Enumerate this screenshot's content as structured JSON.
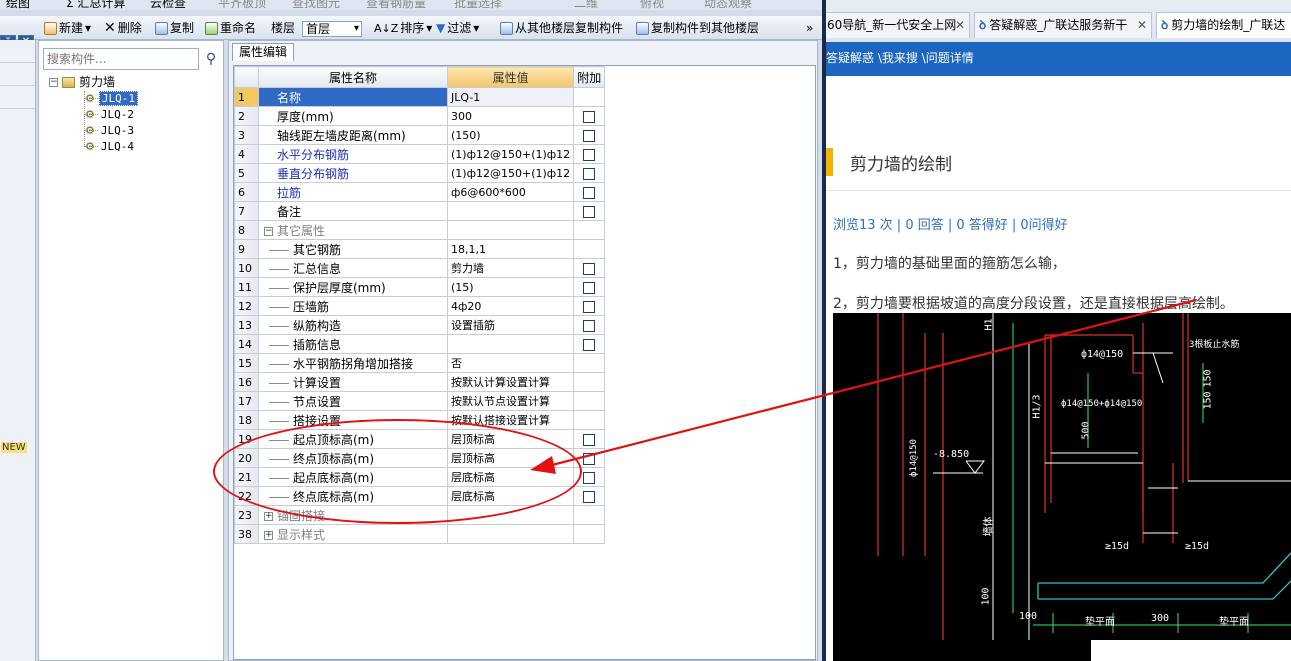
{
  "toolbar_top": {
    "items": [
      "绘图",
      "Σ 汇总计算",
      "云检查",
      "平齐板顶",
      "查找图元",
      "查看钢筋量",
      "批量选择",
      "二维",
      "俯视",
      "动态观察"
    ]
  },
  "toolbar": {
    "new_label": "新建",
    "delete_label": "删除",
    "copy_label": "复制",
    "rename_label": "重命名",
    "floor_label": "楼层",
    "floor_value": "首层",
    "sort_label": "排序",
    "filter_label": "过滤",
    "copy_from_floor_label": "从其他楼层复制构件",
    "copy_to_floor_label": "复制构件到其他楼层",
    "more_label": "»"
  },
  "left_strip": {
    "new_tag": "NEW"
  },
  "tree_panel": {
    "search_placeholder": "搜索构件...",
    "root_label": "剪力墙",
    "items": [
      "JLQ-1",
      "JLQ-2",
      "JLQ-3",
      "JLQ-4"
    ],
    "selected_item": "JLQ-1"
  },
  "property_panel": {
    "tab_label": "属性编辑",
    "columns": [
      "属性名称",
      "属性值",
      "附加"
    ],
    "rows": [
      {
        "num": "1",
        "name": "名称",
        "value": "JLQ-1",
        "check": false,
        "style": "selected"
      },
      {
        "num": "2",
        "name": "厚度(mm)",
        "value": "300",
        "check": true,
        "style": "normal"
      },
      {
        "num": "3",
        "name": "轴线距左墙皮距离(mm)",
        "value": "(150)",
        "check": true,
        "style": "normal"
      },
      {
        "num": "4",
        "name": "水平分布钢筋",
        "value": "(1)ф12@150+(1)ф12",
        "check": true,
        "style": "blue"
      },
      {
        "num": "5",
        "name": "垂直分布钢筋",
        "value": "(1)ф12@150+(1)ф12",
        "check": true,
        "style": "blue"
      },
      {
        "num": "6",
        "name": "拉筋",
        "value": "ф6@600*600",
        "check": true,
        "style": "blue"
      },
      {
        "num": "7",
        "name": "备注",
        "value": "",
        "check": true,
        "style": "normal"
      },
      {
        "num": "8",
        "name": "其它属性",
        "value": "",
        "check": false,
        "style": "group",
        "expander": "−"
      },
      {
        "num": "9",
        "name": "其它钢筋",
        "value": "18,1,1",
        "check": false,
        "style": "sub"
      },
      {
        "num": "10",
        "name": "汇总信息",
        "value": "剪力墙",
        "check": true,
        "style": "sub"
      },
      {
        "num": "11",
        "name": "保护层厚度(mm)",
        "value": "(15)",
        "check": true,
        "style": "sub"
      },
      {
        "num": "12",
        "name": "压墙筋",
        "value": "4ф20",
        "check": true,
        "style": "sub"
      },
      {
        "num": "13",
        "name": "纵筋构造",
        "value": "设置插筋",
        "check": true,
        "style": "sub"
      },
      {
        "num": "14",
        "name": "插筋信息",
        "value": "",
        "check": true,
        "style": "sub"
      },
      {
        "num": "15",
        "name": "水平钢筋拐角增加搭接",
        "value": "否",
        "check": false,
        "style": "sub"
      },
      {
        "num": "16",
        "name": "计算设置",
        "value": "按默认计算设置计算",
        "check": false,
        "style": "sub"
      },
      {
        "num": "17",
        "name": "节点设置",
        "value": "按默认节点设置计算",
        "check": false,
        "style": "sub"
      },
      {
        "num": "18",
        "name": "搭接设置",
        "value": "按默认搭接设置计算",
        "check": false,
        "style": "sub"
      },
      {
        "num": "19",
        "name": "起点顶标高(m)",
        "value": "层顶标高",
        "check": true,
        "style": "sub"
      },
      {
        "num": "20",
        "name": "终点顶标高(m)",
        "value": "层顶标高",
        "check": true,
        "style": "sub"
      },
      {
        "num": "21",
        "name": "起点底标高(m)",
        "value": "层底标高",
        "check": true,
        "style": "sub"
      },
      {
        "num": "22",
        "name": "终点底标高(m)",
        "value": "层底标高",
        "check": true,
        "style": "sub"
      },
      {
        "num": "23",
        "name": "锚固搭接",
        "value": "",
        "check": false,
        "style": "group",
        "expander": "+"
      },
      {
        "num": "38",
        "name": "显示样式",
        "value": "",
        "check": false,
        "style": "group",
        "expander": "+"
      }
    ]
  },
  "browser": {
    "top_items": [
      "..."
    ],
    "tabs": [
      {
        "label": "60导航_新一代安全上网",
        "active": false
      },
      {
        "label": "答疑解惑_广联达服务新干",
        "active": false
      },
      {
        "label": "剪力墙的绘制_广联达",
        "active": true
      }
    ],
    "breadcrumb": "答疑解惑 \\我来搜 \\问题详情",
    "question_title": "剪力墙的绘制",
    "stats": "浏览13 次 | 0 回答 | 0 答得好 | 0问得好",
    "line1": "1，剪力墙的基础里面的箍筋怎么输，",
    "line2": "2，剪力墙要根据坡道的高度分段设置，还是直接根据层高绘制。"
  },
  "cad_labels": {
    "h1": "H1",
    "rebar_a": "ф14@150",
    "anchor": "3根板止水筋",
    "rebar_b": "ф14@150+ф14@150",
    "dim_150a": "150",
    "dim_150b": "150",
    "h13": "H1/3",
    "h500": "500",
    "level": "-8.850",
    "d14": "ф14@150",
    "side": "墙体",
    "l15a": "≥15d",
    "l15b": "≥15d",
    "d100v": "100",
    "d100": "100",
    "base1": "垫平面",
    "d300": "300",
    "base2": "垫平面"
  }
}
